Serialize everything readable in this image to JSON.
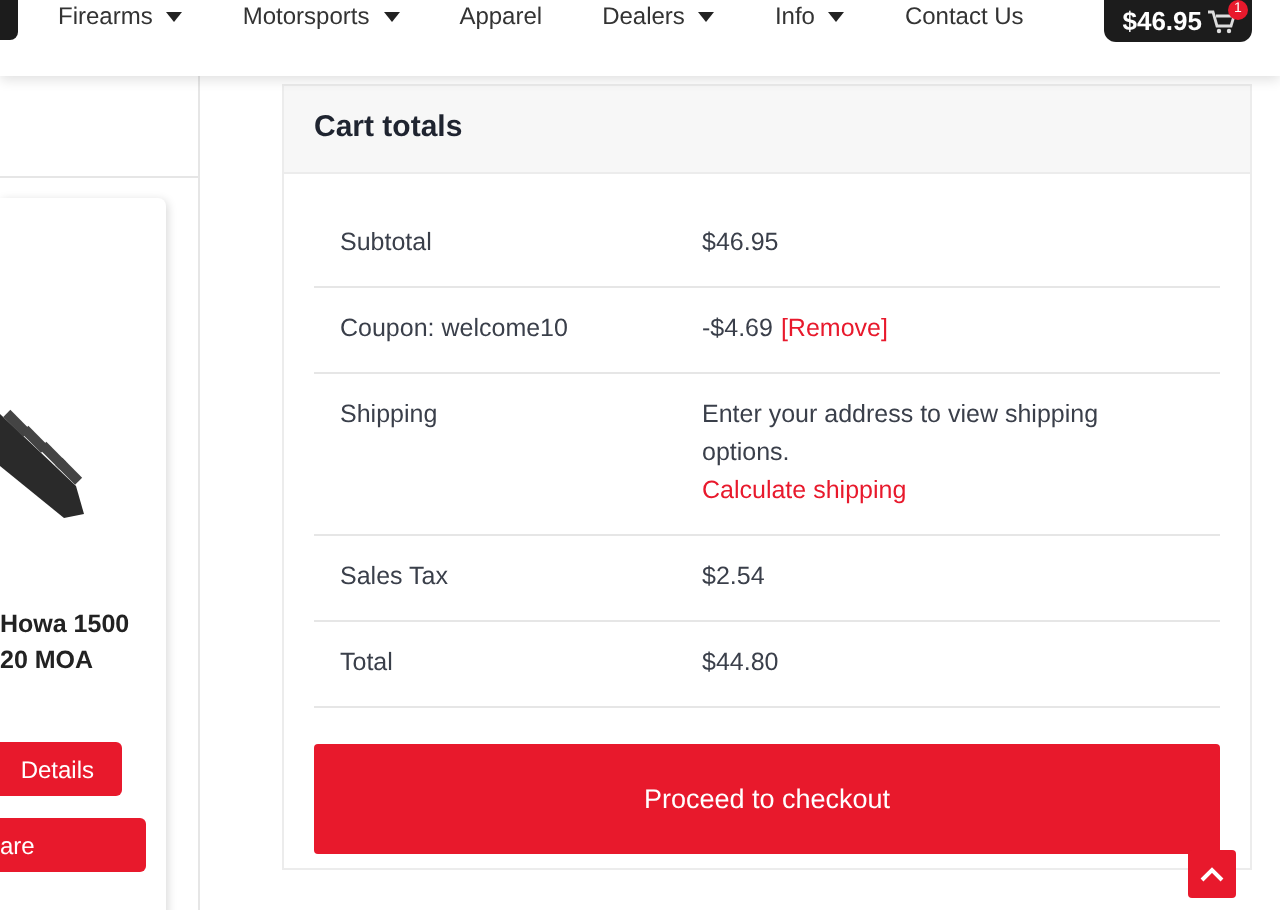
{
  "nav": {
    "items": [
      {
        "label": "Firearms",
        "dropdown": true
      },
      {
        "label": "Motorsports",
        "dropdown": true
      },
      {
        "label": "Apparel",
        "dropdown": false
      },
      {
        "label": "Dealers",
        "dropdown": true
      },
      {
        "label": "Info",
        "dropdown": true
      },
      {
        "label": "Contact Us",
        "dropdown": false
      }
    ],
    "cart": {
      "total": "$46.95",
      "count": "1"
    }
  },
  "product": {
    "title_lines": [
      "Howa 1500",
      "20 MOA"
    ],
    "buttons": [
      "Details",
      "are"
    ]
  },
  "cart_totals": {
    "title": "Cart totals",
    "rows": [
      {
        "kind": "amount",
        "label": "Subtotal",
        "value": "$46.95"
      },
      {
        "kind": "coupon",
        "label": "Coupon: welcome10",
        "value": "-$4.69",
        "link": "[Remove]"
      },
      {
        "kind": "shipping",
        "label": "Shipping",
        "text": "Enter your address to view shipping options.",
        "link": "Calculate shipping"
      },
      {
        "kind": "amount",
        "label": "Sales Tax",
        "value": "$2.54"
      },
      {
        "kind": "amount",
        "label": "Total",
        "value": "$44.80"
      }
    ],
    "checkout": "Proceed to checkout"
  }
}
